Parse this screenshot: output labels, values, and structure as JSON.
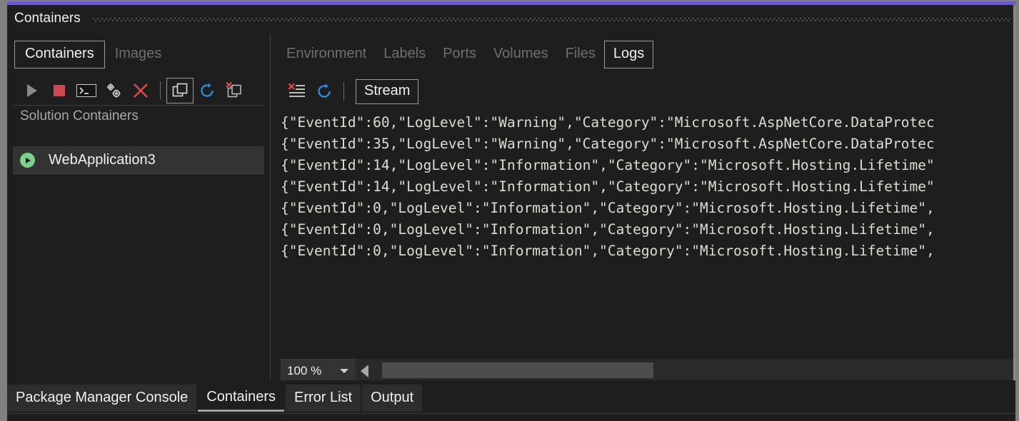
{
  "window": {
    "title": "Containers",
    "accent_color": "#6a5acd"
  },
  "left_pane": {
    "tabs": [
      {
        "label": "Containers",
        "selected": true
      },
      {
        "label": "Images",
        "selected": false
      }
    ],
    "toolbar": [
      {
        "name": "start-button",
        "icon": "play-icon"
      },
      {
        "name": "stop-button",
        "icon": "stop-icon"
      },
      {
        "name": "open-terminal-button",
        "icon": "terminal-icon"
      },
      {
        "name": "settings-button",
        "icon": "gears-icon"
      },
      {
        "name": "delete-container-button",
        "icon": "close-x-icon"
      },
      {
        "name": "show-containers-button",
        "icon": "containers-icon",
        "selected": true
      },
      {
        "name": "refresh-containers-button",
        "icon": "refresh-icon"
      },
      {
        "name": "remove-containers-button",
        "icon": "remove-containers-icon"
      }
    ],
    "list_header": "Solution Containers",
    "items": [
      {
        "name": "WebApplication3",
        "status": "running",
        "status_color": "#7ed08a",
        "selected": true
      }
    ]
  },
  "right_pane": {
    "tabs": [
      {
        "label": "Environment",
        "selected": false
      },
      {
        "label": "Labels",
        "selected": false
      },
      {
        "label": "Ports",
        "selected": false
      },
      {
        "label": "Volumes",
        "selected": false
      },
      {
        "label": "Files",
        "selected": false
      },
      {
        "label": "Logs",
        "selected": true
      }
    ],
    "toolbar": [
      {
        "name": "clear-logs-button",
        "icon": "clear-log-icon"
      },
      {
        "name": "refresh-logs-button",
        "icon": "refresh-icon"
      }
    ],
    "stream_button": "Stream",
    "log_lines": [
      "{\"EventId\":60,\"LogLevel\":\"Warning\",\"Category\":\"Microsoft.AspNetCore.DataProtec",
      "{\"EventId\":35,\"LogLevel\":\"Warning\",\"Category\":\"Microsoft.AspNetCore.DataProtec",
      "{\"EventId\":14,\"LogLevel\":\"Information\",\"Category\":\"Microsoft.Hosting.Lifetime\"",
      "{\"EventId\":14,\"LogLevel\":\"Information\",\"Category\":\"Microsoft.Hosting.Lifetime\"",
      "{\"EventId\":0,\"LogLevel\":\"Information\",\"Category\":\"Microsoft.Hosting.Lifetime\",",
      "{\"EventId\":0,\"LogLevel\":\"Information\",\"Category\":\"Microsoft.Hosting.Lifetime\",",
      "{\"EventId\":0,\"LogLevel\":\"Information\",\"Category\":\"Microsoft.Hosting.Lifetime\","
    ],
    "zoom_value": "100 %"
  },
  "bottom_tabs": [
    {
      "label": "Package Manager Console",
      "active": false
    },
    {
      "label": "Containers",
      "active": true
    },
    {
      "label": "Error List",
      "active": false
    },
    {
      "label": "Output",
      "active": false
    }
  ]
}
